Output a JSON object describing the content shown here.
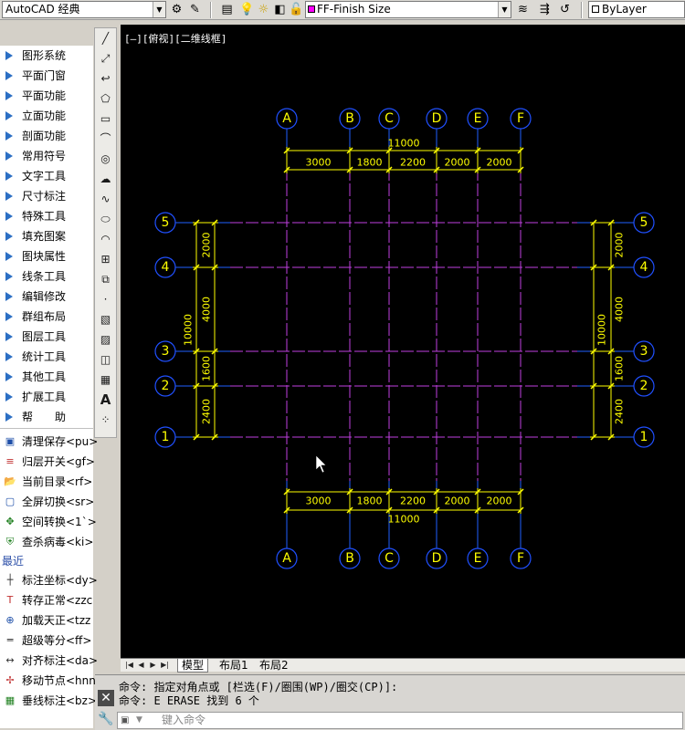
{
  "toolbar": {
    "workspace": "AutoCAD 经典",
    "layer": "FF-Finish Size",
    "color": "ByLayer"
  },
  "view_label": "[—][俯视][二维线框]",
  "left_menu": {
    "groups": [
      "图形系统",
      "平面门窗",
      "平面功能",
      "立面功能",
      "剖面功能",
      "常用符号",
      "文字工具",
      "尺寸标注",
      "特殊工具",
      "填充图案",
      "图块属性",
      "线条工具",
      "编辑修改",
      "群组布局",
      "图层工具",
      "统计工具",
      "其他工具",
      "扩展工具",
      "帮　　助"
    ],
    "commands": [
      {
        "label": "清理保存<pu>",
        "icon": "save-icon"
      },
      {
        "label": "归层开关<gf>",
        "icon": "layers-icon"
      },
      {
        "label": "当前目录<rf>",
        "icon": "folder-icon"
      },
      {
        "label": "全屏切换<sr>",
        "icon": "fullscreen-icon"
      },
      {
        "label": "空间转换<1`>",
        "icon": "space-switch-icon"
      },
      {
        "label": "查杀病毒<ki>",
        "icon": "shield-icon"
      }
    ],
    "recent_label": "最近",
    "recent": [
      {
        "label": "标注坐标<dy>",
        "icon": "coordinate-icon"
      },
      {
        "label": "转存正常<zzc",
        "icon": "convert-icon"
      },
      {
        "label": "加载天正<tzz",
        "icon": "load-icon"
      },
      {
        "label": "超级等分<ff>",
        "icon": "divide-icon"
      },
      {
        "label": "对齐标注<da>",
        "icon": "align-dim-icon"
      },
      {
        "label": "移动节点<hnn",
        "icon": "move-node-icon"
      },
      {
        "label": "垂线标注<bz>",
        "icon": "perp-dim-icon"
      }
    ]
  },
  "drawing": {
    "column_labels": [
      "A",
      "B",
      "C",
      "D",
      "E",
      "F"
    ],
    "row_labels": [
      "5",
      "4",
      "3",
      "2",
      "1"
    ],
    "horizontal_spacings": [
      "3000",
      "1800",
      "2200",
      "2000",
      "2000"
    ],
    "horizontal_total": "11000",
    "vertical_spacings_top_to_bottom": [
      "2000",
      "4000",
      "1600",
      "2400"
    ],
    "vertical_total": "10000",
    "colors": {
      "grid_line": "#c040e0",
      "bubble": "#2050ff",
      "dim": "#ffff00",
      "axis_blue": "#2060ff"
    }
  },
  "tabs": [
    "模型",
    "布局1",
    "布局2"
  ],
  "command": {
    "line1": "命令: 指定对角点或 [栏选(F)/圈围(WP)/圈交(CP)]:",
    "line2": "命令: E ERASE 找到 6 个",
    "placeholder": "键入命令"
  }
}
